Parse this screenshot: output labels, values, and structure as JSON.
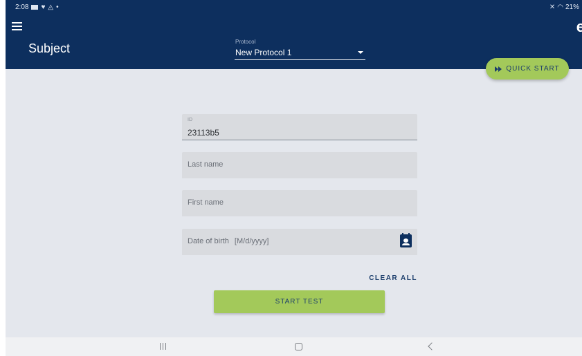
{
  "status_bar": {
    "time": "2:08",
    "battery": "21%"
  },
  "header": {
    "title": "Subject",
    "protocol": {
      "caption": "Protocol",
      "selected": "New Protocol 1"
    },
    "quick_start_label": "QUICK START"
  },
  "form": {
    "id_field": {
      "label": "ID",
      "value": "23113b5"
    },
    "last_name_placeholder": "Last name",
    "first_name_placeholder": "First name",
    "dob_label": "Date of birth",
    "dob_format": "[M/d/yyyy]",
    "clear_all_label": "CLEAR ALL",
    "start_test_label": "START TEST"
  },
  "colors": {
    "primary": "#0d2f5e",
    "accent": "#a3c95a",
    "background": "#e4e7ed"
  },
  "icons": {
    "menu": "menu-icon",
    "logo": "app-logo-icon",
    "dropdown": "chevron-down-icon",
    "quick_start": "fast-forward-icon",
    "calendar": "calendar-person-icon",
    "nav_recents": "recents-icon",
    "nav_home": "home-icon",
    "nav_back": "back-icon"
  }
}
